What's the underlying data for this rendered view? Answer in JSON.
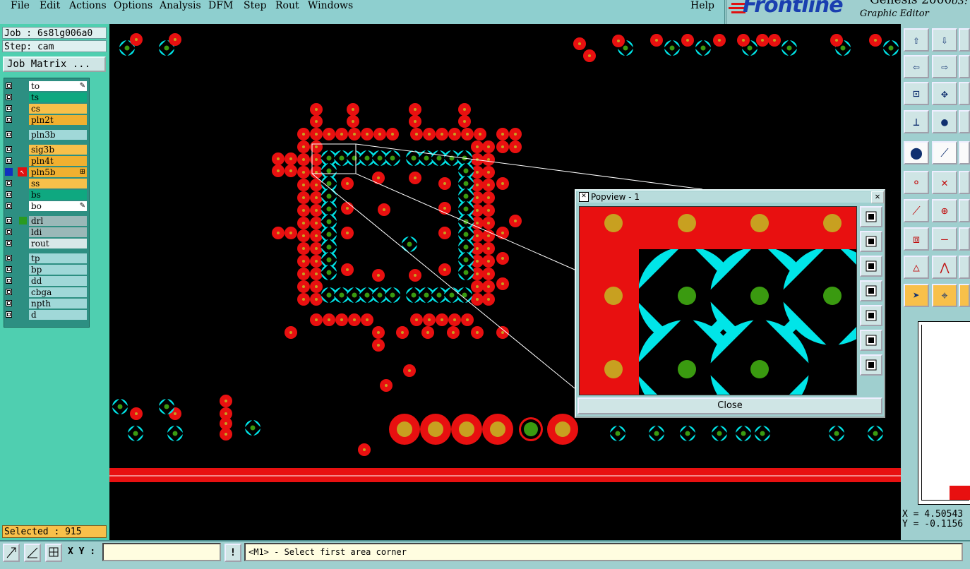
{
  "menu": {
    "items": [
      "File",
      "Edit",
      "Actions",
      "Options",
      "Analysis",
      "DFM",
      "Step",
      "Rout",
      "Windows"
    ],
    "help": "Help"
  },
  "logo": {
    "brand": "Frontline",
    "product": "Genesis 2000",
    "subtitle": "Graphic Editor",
    "time": "03:"
  },
  "left_panel": {
    "job": "Job : 6s8lg006a0",
    "step": "Step: cam",
    "job_matrix": "Job Matrix ...",
    "layers": [
      {
        "name": "to",
        "color": "#ffffff",
        "mark": "✎"
      },
      {
        "name": "ts",
        "color": "#0fa880",
        "mark": ""
      },
      {
        "name": "cs",
        "color": "#f8c04a",
        "mark": ""
      },
      {
        "name": "pln2t",
        "color": "#f0b030",
        "mark": ""
      },
      {
        "name": "pln3b",
        "color": "#a0d8d8",
        "mark": ""
      },
      {
        "name": "sig3b",
        "color": "#f8c04a",
        "mark": ""
      },
      {
        "name": "pln4t",
        "color": "#f0b030",
        "mark": ""
      },
      {
        "name": "pln5b",
        "color": "#f0b030",
        "mark": "⊞"
      },
      {
        "name": "ss",
        "color": "#f8c04a",
        "mark": ""
      },
      {
        "name": "bs",
        "color": "#0fa880",
        "mark": ""
      },
      {
        "name": "bo",
        "color": "#ffffff",
        "mark": "✎"
      },
      {
        "name": "drl",
        "color": "#9ab8b8",
        "mark": ""
      },
      {
        "name": "ldi",
        "color": "#9ab8b8",
        "mark": ""
      },
      {
        "name": "rout",
        "color": "#d8e8e8",
        "mark": ""
      },
      {
        "name": "tp",
        "color": "#a0d8d8",
        "mark": ""
      },
      {
        "name": "bp",
        "color": "#a0d8d8",
        "mark": ""
      },
      {
        "name": "dd",
        "color": "#a0d8d8",
        "mark": ""
      },
      {
        "name": "cbga",
        "color": "#a0d8d8",
        "mark": ""
      },
      {
        "name": "npth",
        "color": "#a0d8d8",
        "mark": ""
      },
      {
        "name": "d",
        "color": "#a0d8d8",
        "mark": ""
      }
    ],
    "selected": "Selected : 915"
  },
  "popview": {
    "title": "Popview - 1",
    "close_label": "Close",
    "close_x": "✕"
  },
  "status": {
    "xy_label": "X Y :",
    "xy_value": "",
    "prompt": "<M1> - Select first area corner",
    "prompt_icon": "!"
  },
  "coordinates": {
    "x": "X = 4.50543",
    "y": "Y = -0.1156"
  },
  "colors": {
    "pad_red": "#e81010",
    "pad_cyan": "#00e5e8",
    "pad_gold": "#c8a020",
    "pad_green": "#3a9a10",
    "background": "#000000"
  },
  "icons": {
    "toolbar": [
      "zoom-in-icon",
      "zoom-out-icon",
      "pan-left-icon",
      "pan-right-icon",
      "fit-icon",
      "center-icon",
      "measure-icon",
      "drill-icon",
      "select-icon",
      "draw-icon",
      "net-icon",
      "delete-icon",
      "line-icon",
      "snap-icon",
      "add-pad-icon",
      "cut-icon",
      "triangle-icon",
      "arc-icon",
      "pointer-icon",
      "edit-pointer-icon"
    ]
  }
}
